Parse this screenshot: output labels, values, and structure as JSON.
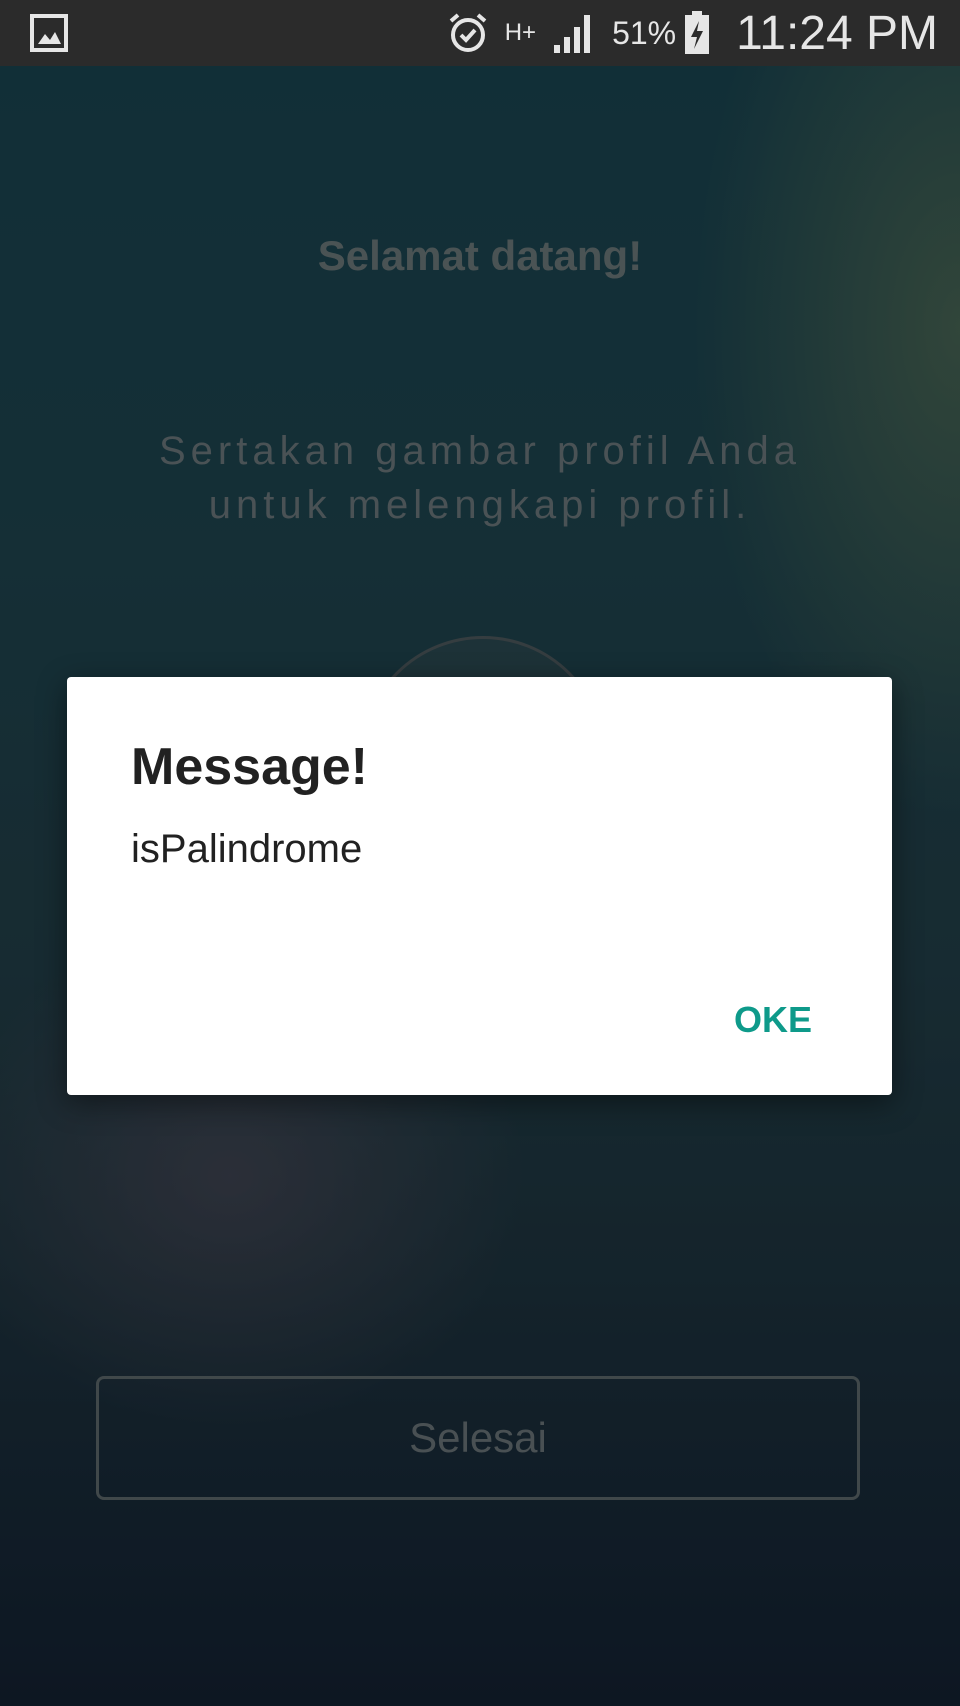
{
  "status_bar": {
    "network_type": "H+",
    "battery_percent": "51%",
    "time": "11:24 PM",
    "icons": [
      "image-notification-icon",
      "alarm-icon",
      "data-arrows-icon",
      "signal-icon",
      "battery-charging-icon"
    ]
  },
  "screen": {
    "welcome": "Selamat datang!",
    "instruction": "Sertakan gambar profil Anda untuk melengkapi profil.",
    "done_button": "Selesai"
  },
  "dialog": {
    "title": "Message!",
    "message": "isPalindrome",
    "ok_button": "OKE",
    "accent_color": "#0e9a8a"
  }
}
